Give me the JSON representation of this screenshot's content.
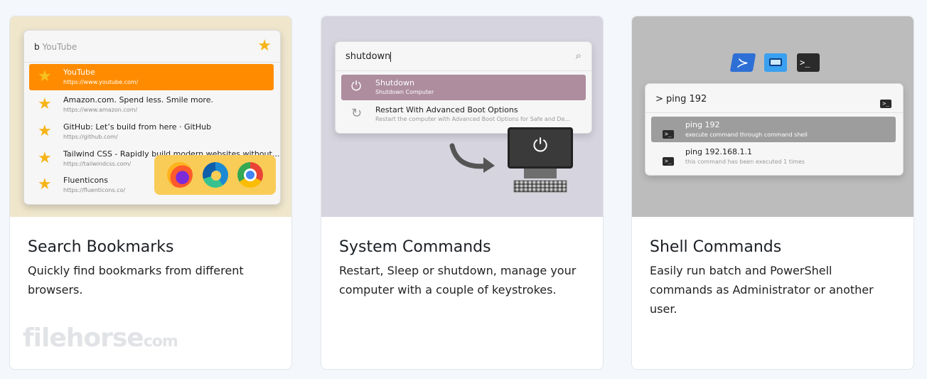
{
  "cards": [
    {
      "title": "Search Bookmarks",
      "description": "Quickly find bookmarks from different browsers.",
      "preview": {
        "search_prefix": "b",
        "search_hint": "YouTube",
        "items": [
          {
            "title": "YouTube",
            "url": "https://www.youtube.com/",
            "selected": true
          },
          {
            "title": "Amazon.com. Spend less. Smile more.",
            "url": "https://www.amazon.com/"
          },
          {
            "title": "GitHub: Let’s build from here · GitHub",
            "url": "https://github.com/"
          },
          {
            "title": "Tailwind CSS - Rapidly build modern websites without...",
            "url": "https://tailwindcss.com/"
          },
          {
            "title": "Fluenticons",
            "url": "https://fluenticons.co/"
          }
        ],
        "browser_icons": [
          "firefox-icon",
          "edge-icon",
          "chrome-icon"
        ]
      }
    },
    {
      "title": "System Commands",
      "description": "Restart, Sleep or shutdown, manage your computer with a couple of keystrokes.",
      "preview": {
        "search_value": "shutdown",
        "items": [
          {
            "title": "Shutdown",
            "subtitle": "Shutdown Computer",
            "icon": "power-icon",
            "selected": true
          },
          {
            "title": "Restart With Advanced Boot Options",
            "subtitle": "Restart the computer with Advanced Boot Options for Safe and De...",
            "icon": "restart-icon"
          }
        ]
      }
    },
    {
      "title": "Shell Commands",
      "description": "Easily run batch and PowerShell commands as Administrator or another user.",
      "preview": {
        "search_value": "> ping 192",
        "items": [
          {
            "title": "ping 192",
            "subtitle": "execute command through command shell",
            "selected": true
          },
          {
            "title": "ping 192.168.1.1",
            "subtitle": "this command has been executed 1 times"
          }
        ],
        "shell_icons": [
          "powershell-icon",
          "window-icon",
          "terminal-icon"
        ]
      }
    }
  ],
  "watermark": {
    "text": "filehorse",
    "suffix": "com"
  },
  "colors": {
    "bookmark_highlight": "#ff8c00",
    "system_highlight": "#ad8d9e",
    "shell_highlight": "#9d9d9d",
    "star": "#f6b417"
  }
}
